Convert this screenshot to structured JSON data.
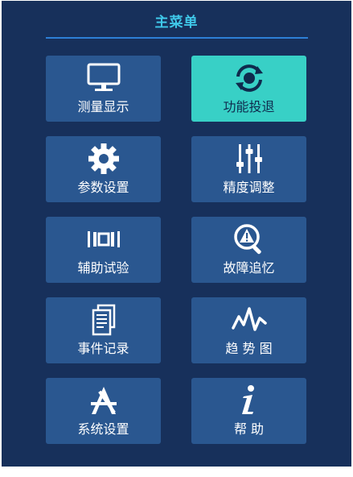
{
  "header": {
    "title": "主菜单"
  },
  "menu": {
    "items": [
      {
        "id": "measure",
        "label": "测量显示",
        "icon": "monitor-icon"
      },
      {
        "id": "function",
        "label": "功能投退",
        "icon": "toggle-cycle-icon",
        "active": true
      },
      {
        "id": "params",
        "label": "参数设置",
        "icon": "gear-icon"
      },
      {
        "id": "precision",
        "label": "精度调整",
        "icon": "sliders-icon"
      },
      {
        "id": "test",
        "label": "辅助试验",
        "icon": "test-bracket-icon"
      },
      {
        "id": "fault",
        "label": "故障追忆",
        "icon": "warning-search-icon"
      },
      {
        "id": "events",
        "label": "事件记录",
        "icon": "document-list-icon"
      },
      {
        "id": "trend",
        "label": "趋 势 图",
        "icon": "waveform-icon"
      },
      {
        "id": "system",
        "label": "系统设置",
        "icon": "tools-icon"
      },
      {
        "id": "help",
        "label": "帮 助",
        "icon": "info-icon"
      }
    ]
  },
  "colors": {
    "background": "#17305b",
    "tile": "#2a5790",
    "tile_active": "#38d0c6",
    "title": "#3fc7e8",
    "divider": "#2d7fd6"
  }
}
